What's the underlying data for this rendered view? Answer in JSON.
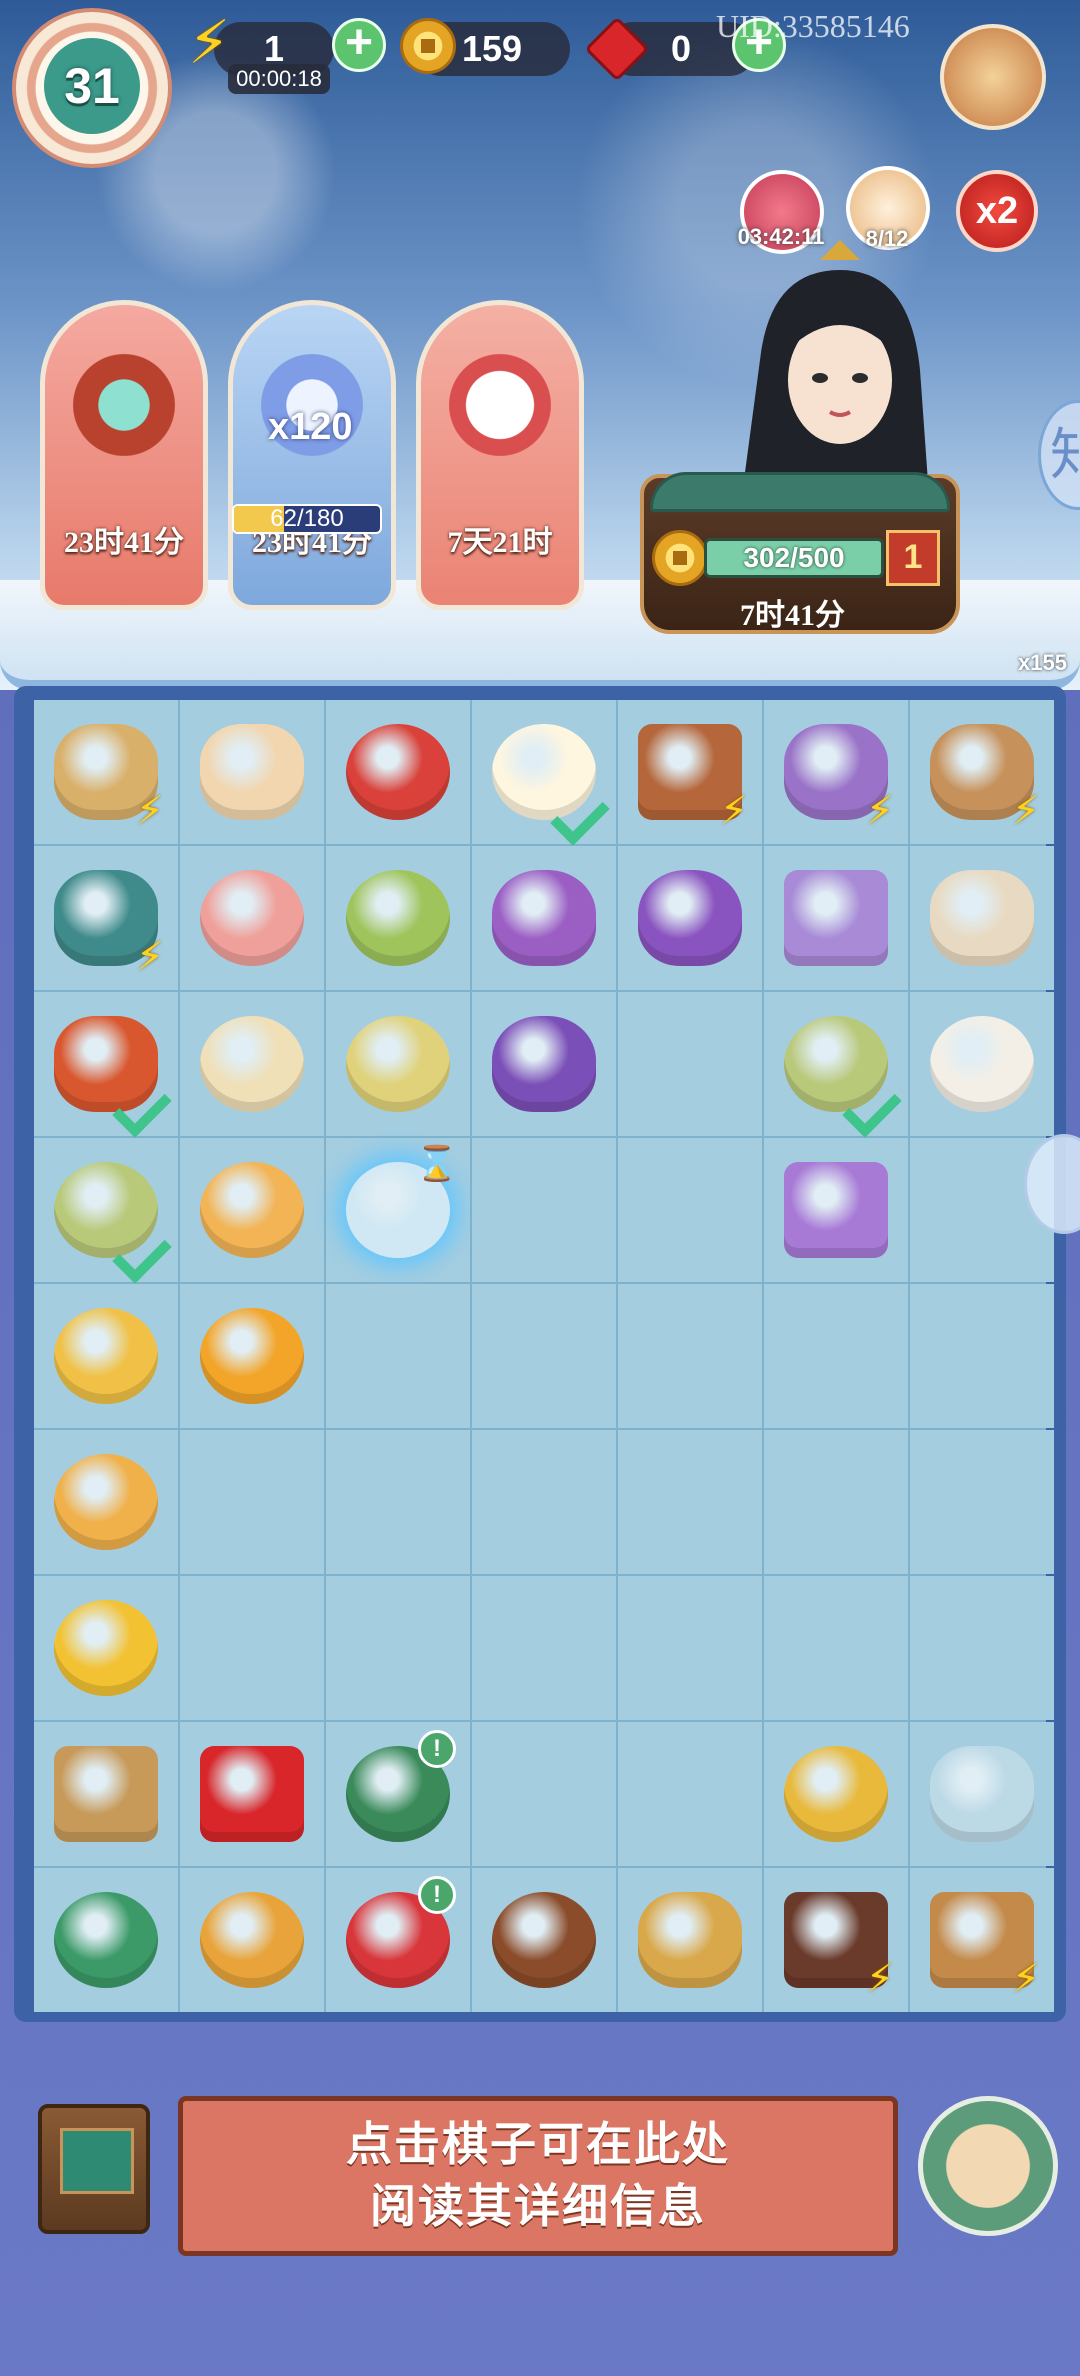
{
  "top_bar": {
    "level": "31",
    "energy": "1",
    "energy_timer": "00:00:18",
    "coins": "159",
    "gems": "0",
    "uid": "UID:33585146"
  },
  "buffs": {
    "flower_timer": "03:42:11",
    "cat_count": "8/12",
    "multiplier": "x2"
  },
  "events": [
    {
      "name": "drum-event",
      "label": "23时41分",
      "color": "#e77a6b"
    },
    {
      "name": "crystal-event",
      "label": "23时41分",
      "color": "#8eb6e8",
      "multiplier": "x120",
      "progress_text": "62/180",
      "progress": 0.344
    },
    {
      "name": "fox-event",
      "label": "7天21时",
      "color": "#ea8374"
    }
  ],
  "shrine": {
    "exp_text": "302/500",
    "exp": 0.604,
    "level": "1",
    "timer": "7时41分"
  },
  "side": {
    "avatar_glyph": "知",
    "item_count": "x155"
  },
  "board": {
    "rows": [
      [
        {
          "name": "fruit-basket",
          "color": "#d9b06a",
          "mark": "bolt"
        },
        {
          "name": "rice-rolls",
          "color": "#f1d6b0"
        },
        {
          "name": "watermelon",
          "color": "#d9413a",
          "shape": "round"
        },
        {
          "name": "fried-egg",
          "color": "#fff6df",
          "mark": "check",
          "shape": "round"
        },
        {
          "name": "chicken-coop",
          "color": "#b5663a",
          "mark": "bolt",
          "shape": "box"
        },
        {
          "name": "spinning-wheel",
          "color": "#9a73c8",
          "mark": "bolt"
        },
        {
          "name": "loom",
          "color": "#c6915a",
          "mark": "bolt"
        }
      ],
      [
        {
          "name": "teapot",
          "color": "#3f8a8a",
          "mark": "bolt"
        },
        {
          "name": "peach-bun",
          "color": "#f0a09a",
          "shape": "round"
        },
        {
          "name": "mung-bean-soup",
          "color": "#9fc45c",
          "shape": "round"
        },
        {
          "name": "purple-pouch",
          "color": "#9b5fc4",
          "shape": "bag"
        },
        {
          "name": "purple-purse",
          "color": "#8a54c0",
          "shape": "bag"
        },
        {
          "name": "silk-scroll",
          "color": "#a88ad6",
          "shape": "box"
        },
        {
          "name": "cotton-spindle",
          "color": "#e8dac2"
        }
      ],
      [
        {
          "name": "fruit-platter",
          "color": "#d9572f",
          "mark": "check"
        },
        {
          "name": "rice-porridge",
          "color": "#efe0b8",
          "shape": "round"
        },
        {
          "name": "green-tea-bowl",
          "color": "#e0d27a",
          "shape": "round"
        },
        {
          "name": "lotus-pouch",
          "color": "#7b4fb8",
          "shape": "bag"
        },
        null,
        {
          "name": "fruit-soup",
          "color": "#b9c97a",
          "mark": "check",
          "shape": "round"
        },
        {
          "name": "cotton-basket",
          "color": "#f4efe6",
          "shape": "round"
        }
      ],
      [
        {
          "name": "fruit-soup-2",
          "color": "#b9c97a",
          "mark": "check",
          "shape": "round"
        },
        {
          "name": "empty-porcelain-cup",
          "color": "#f2b455",
          "shape": "round"
        },
        {
          "name": "frozen-tea-set",
          "color": "#cfe8f4",
          "mark": "hourglass",
          "frozen": true,
          "shape": "round"
        },
        null,
        null,
        {
          "name": "folded-silk",
          "color": "#a77ad6",
          "shape": "box"
        },
        null
      ],
      [
        {
          "name": "blue-tea-cup",
          "color": "#f0c146",
          "shape": "round"
        },
        {
          "name": "chrysanthemum-tea",
          "color": "#f3a52a",
          "shape": "round"
        },
        null,
        null,
        null,
        null,
        null
      ],
      [
        {
          "name": "porcelain-cup",
          "color": "#f0b04a",
          "shape": "round"
        },
        null,
        null,
        null,
        null,
        null,
        null
      ],
      [
        {
          "name": "gold-coins",
          "color": "#f2c233",
          "shape": "round"
        },
        null,
        null,
        null,
        null,
        null,
        null
      ],
      [
        {
          "name": "tea-box",
          "color": "#c79a5a",
          "shape": "box"
        },
        {
          "name": "red-gem",
          "color": "#d8262a",
          "shape": "box"
        },
        {
          "name": "green-tea-tin",
          "color": "#3a8a5a",
          "mark": "alert",
          "shape": "round"
        },
        null,
        null,
        {
          "name": "gold-ring",
          "color": "#e8b93b",
          "shape": "round"
        },
        {
          "name": "jade-pendant",
          "color": "#bcd9e6"
        }
      ],
      [
        {
          "name": "green-gourd",
          "color": "#3c9a68",
          "shape": "round"
        },
        {
          "name": "gold-gourd",
          "color": "#e8a43a",
          "shape": "round"
        },
        {
          "name": "red-tea-tin",
          "color": "#d8363a",
          "mark": "alert",
          "shape": "round"
        },
        {
          "name": "bird-nest",
          "color": "#8a4c2a",
          "shape": "round"
        },
        {
          "name": "brush-and-scrolls",
          "color": "#d9a84a"
        },
        {
          "name": "treasure-chest",
          "color": "#6a3a2a",
          "mark": "bolt",
          "shape": "box"
        },
        {
          "name": "scroll-crate",
          "color": "#c48a4a",
          "mark": "bolt",
          "shape": "box"
        }
      ]
    ]
  },
  "info": {
    "line1": "点击棋子可在此处",
    "line2": "阅读其详细信息"
  },
  "icons": {
    "energy": "lightning-icon",
    "plus": "plus-icon",
    "coin": "coin-icon",
    "gem": "red-gem-icon",
    "bolt_glyph": "⚡",
    "check": "check-icon",
    "alert_glyph": "!",
    "hourglass_glyph": "⌛",
    "plus_glyph": "+"
  }
}
